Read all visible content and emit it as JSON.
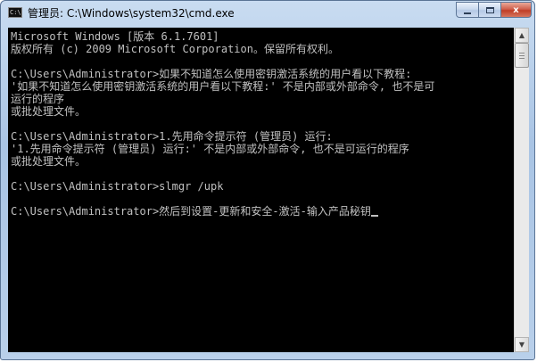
{
  "window": {
    "title": "管理员: C:\\Windows\\system32\\cmd.exe",
    "icon": "cmd-icon",
    "icon_text": "C:\\",
    "controls": {
      "minimize": "minimize-icon",
      "maximize": "maximize-icon",
      "close_label": "x"
    }
  },
  "console": {
    "lines": [
      "Microsoft Windows [版本 6.1.7601]",
      "版权所有 (c) 2009 Microsoft Corporation。保留所有权利。",
      "",
      "C:\\Users\\Administrator>如果不知道怎么使用密钥激活系统的用户看以下教程:",
      "'如果不知道怎么使用密钥激活系统的用户看以下教程:' 不是内部或外部命令, 也不是可",
      "运行的程序",
      "或批处理文件。",
      "",
      "C:\\Users\\Administrator>1.先用命令提示符 (管理员) 运行:",
      "'1.先用命令提示符 (管理员) 运行:' 不是内部或外部命令, 也不是可运行的程序",
      "或批处理文件。",
      "",
      "C:\\Users\\Administrator>slmgr /upk",
      "",
      "C:\\Users\\Administrator>然后到设置-更新和安全-激活-输入产品秘钥"
    ]
  },
  "scrollbar": {
    "up_arrow": "▲",
    "down_arrow": "▼"
  },
  "colors": {
    "console_bg": "#000000",
    "console_fg": "#c0c0c0",
    "close_button": "#c03e27"
  }
}
